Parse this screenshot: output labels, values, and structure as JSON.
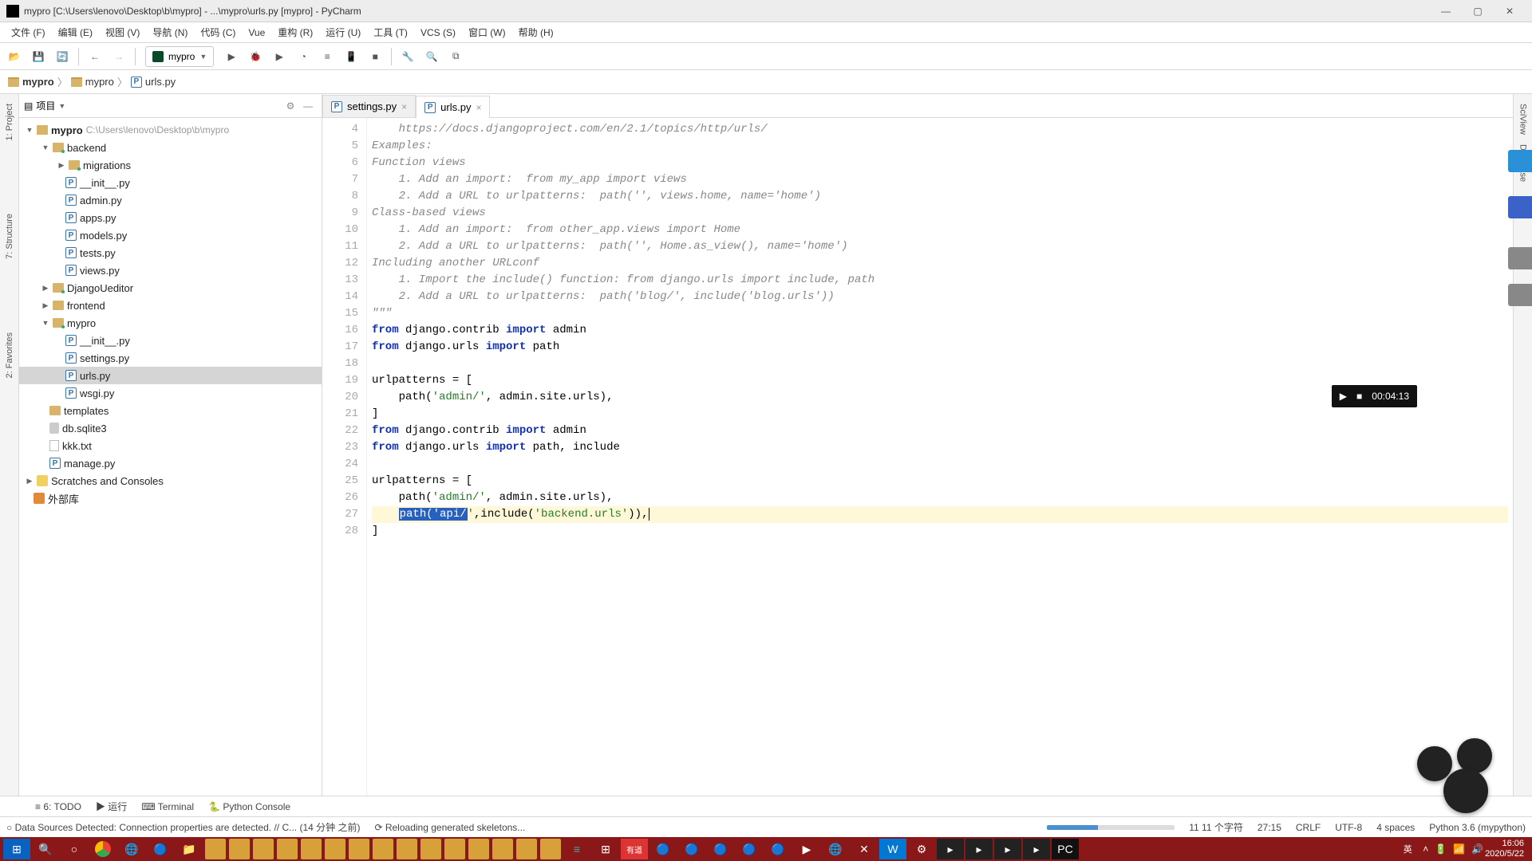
{
  "titlebar": {
    "text": "mypro [C:\\Users\\lenovo\\Desktop\\b\\mypro] - ...\\mypro\\urls.py [mypro] - PyCharm"
  },
  "menu": [
    "文件 (F)",
    "编辑 (E)",
    "视图 (V)",
    "导航 (N)",
    "代码 (C)",
    "Vue",
    "重构 (R)",
    "运行 (U)",
    "工具 (T)",
    "VCS (S)",
    "窗口 (W)",
    "帮助 (H)"
  ],
  "runconfig": "mypro",
  "breadcrumb": [
    "mypro",
    "mypro",
    "urls.py"
  ],
  "leftTabs": [
    "1: Project",
    "7: Structure",
    "2: Favorites"
  ],
  "rightTabs": [
    "SciView",
    "Database"
  ],
  "projectHeader": {
    "label": "项目"
  },
  "tree": {
    "root": {
      "name": "mypro",
      "path": "C:\\Users\\lenovo\\Desktop\\b\\mypro"
    },
    "backend": {
      "name": "backend",
      "children": [
        "migrations",
        "__init__.py",
        "admin.py",
        "apps.py",
        "models.py",
        "tests.py",
        "views.py"
      ]
    },
    "others": [
      "DjangoUeditor",
      "frontend"
    ],
    "mypro": {
      "name": "mypro",
      "children": [
        "__init__.py",
        "settings.py",
        "urls.py",
        "wsgi.py"
      ]
    },
    "rootFiles": [
      "templates",
      "db.sqlite3",
      "kkk.txt",
      "manage.py"
    ],
    "bottom": [
      "Scratches and Consoles",
      "外部库"
    ]
  },
  "tabs": [
    {
      "name": "settings.py",
      "active": false
    },
    {
      "name": "urls.py",
      "active": true
    }
  ],
  "video": {
    "time": "00:04:13"
  },
  "code": {
    "lines": [
      {
        "n": 4,
        "t": "    https://docs.djangoproject.com/en/2.1/topics/http/urls/",
        "cls": "c-com"
      },
      {
        "n": 5,
        "t": "Examples:",
        "cls": "c-com"
      },
      {
        "n": 6,
        "t": "Function views",
        "cls": "c-com"
      },
      {
        "n": 7,
        "t": "    1. Add an import:  from my_app import views",
        "cls": "c-com"
      },
      {
        "n": 8,
        "t": "    2. Add a URL to urlpatterns:  path('', views.home, name='home')",
        "cls": "c-com"
      },
      {
        "n": 9,
        "t": "Class-based views",
        "cls": "c-com"
      },
      {
        "n": 10,
        "t": "    1. Add an import:  from other_app.views import Home",
        "cls": "c-com"
      },
      {
        "n": 11,
        "t": "    2. Add a URL to urlpatterns:  path('', Home.as_view(), name='home')",
        "cls": "c-com"
      },
      {
        "n": 12,
        "t": "Including another URLconf",
        "cls": "c-com"
      },
      {
        "n": 13,
        "t": "    1. Import the include() function: from django.urls import include, path",
        "cls": "c-com"
      },
      {
        "n": 14,
        "t": "    2. Add a URL to urlpatterns:  path('blog/', include('blog.urls'))",
        "cls": "c-com"
      },
      {
        "n": 15,
        "t": "\"\"\"",
        "cls": "c-com"
      }
    ],
    "l16": {
      "n": 16,
      "kw1": "from",
      "mid1": " django.contrib ",
      "kw2": "import",
      "mid2": " admin"
    },
    "l17": {
      "n": 17,
      "kw1": "from",
      "mid1": " django.urls ",
      "kw2": "import",
      "mid2": " path"
    },
    "l18": {
      "n": 18,
      "t": ""
    },
    "l19": {
      "n": 19,
      "t": "urlpatterns = ["
    },
    "l20": {
      "n": 20,
      "pre": "    path(",
      "s": "'admin/'",
      "post": ", admin.site.urls),"
    },
    "l21": {
      "n": 21,
      "t": "]"
    },
    "l22": {
      "n": 22,
      "kw1": "from",
      "mid1": " django.contrib ",
      "kw2": "import",
      "mid2": " admin"
    },
    "l23": {
      "n": 23,
      "kw1": "from",
      "mid1": " django.urls ",
      "kw2": "import",
      "mid2": " path, include"
    },
    "l24": {
      "n": 24,
      "t": ""
    },
    "l25": {
      "n": 25,
      "t": "urlpatterns = ["
    },
    "l26": {
      "n": 26,
      "pre": "    path(",
      "s": "'admin/'",
      "post": ", admin.site.urls),"
    },
    "l27": {
      "n": 27,
      "sel": "path('api/",
      "post1": "'",
      "post2": ",include(",
      "s2": "'backend.urls'",
      "post3": ")),"
    },
    "l28": {
      "n": 28,
      "t": "]"
    }
  },
  "toolwins": [
    "≡ 6: TODO",
    "▶ 运行",
    "⌨ Terminal",
    "🐍 Python Console"
  ],
  "status": {
    "msg": "○ Data Sources Detected: Connection properties are detected. // C... (14 分钟 之前)",
    "reload": "⟳ Reloading generated skeletons...",
    "chars": "11 11 个字符",
    "pos": "27:15",
    "eol": "CRLF",
    "enc": "UTF-8",
    "indent": "4 spaces",
    "python": "Python 3.6 (mypython)"
  },
  "taskbar": {
    "time": "16:06",
    "date": "2020/5/22",
    "ime": "英"
  }
}
